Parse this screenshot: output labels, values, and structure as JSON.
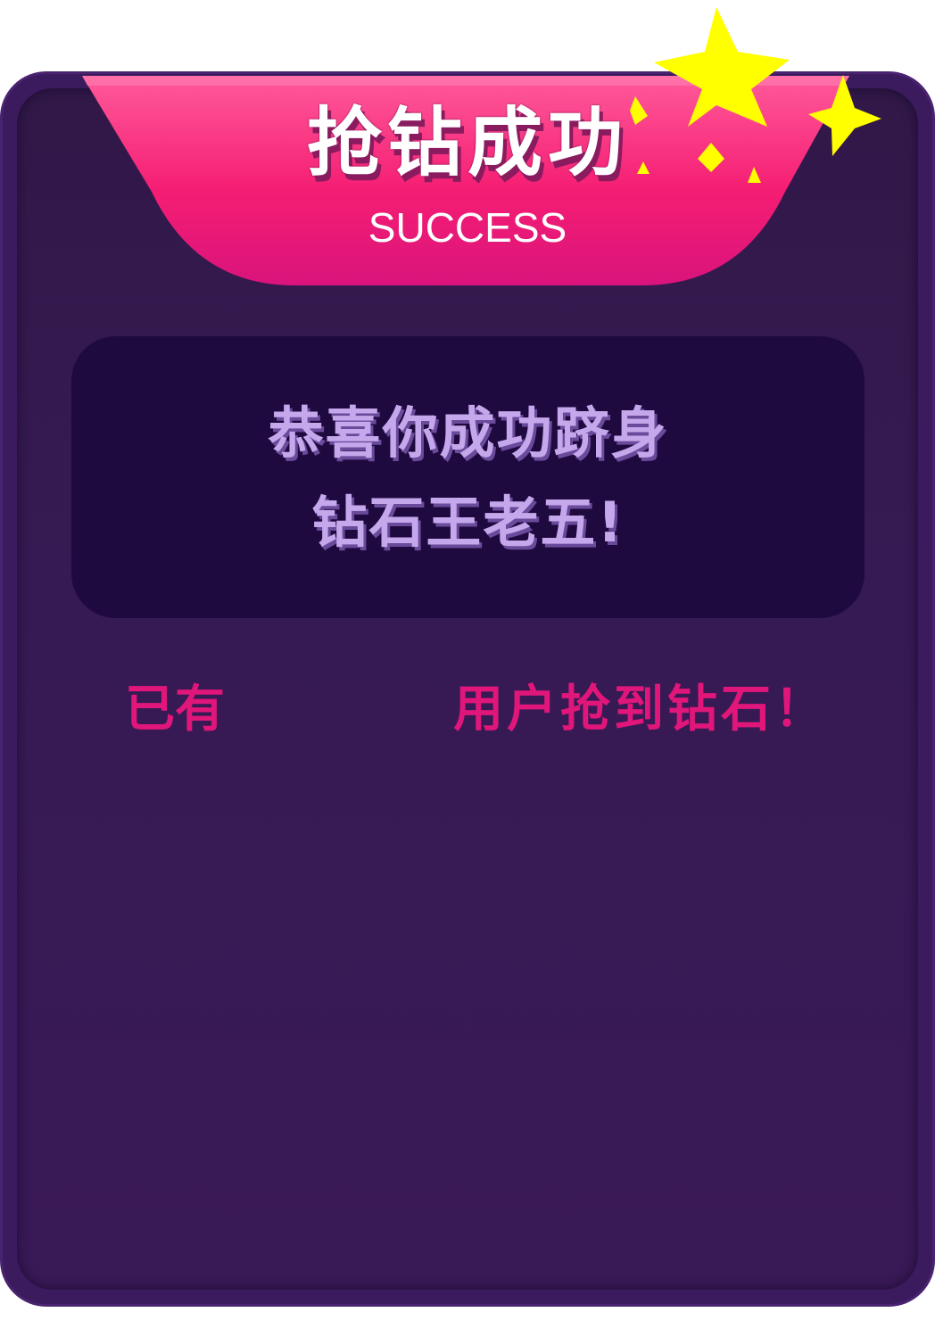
{
  "header": {
    "title": "抢钻成功",
    "subtitle": "SUCCESS"
  },
  "message": {
    "line1": "恭喜你成功跻身",
    "line2": "钻石王老五!"
  },
  "stats": {
    "prefix": "已有",
    "count": "",
    "suffix": "用户抢到钻石！"
  },
  "colors": {
    "panel": "#361a53",
    "ribbon_top": "#ff3a86",
    "ribbon_bottom": "#d9147c",
    "message_box": "#1f0a3f",
    "message_text": "#c5a8ec",
    "stats_text": "#e0167a",
    "star": "#ffff00"
  },
  "icons": [
    "star-icon",
    "sparkle-icon"
  ]
}
